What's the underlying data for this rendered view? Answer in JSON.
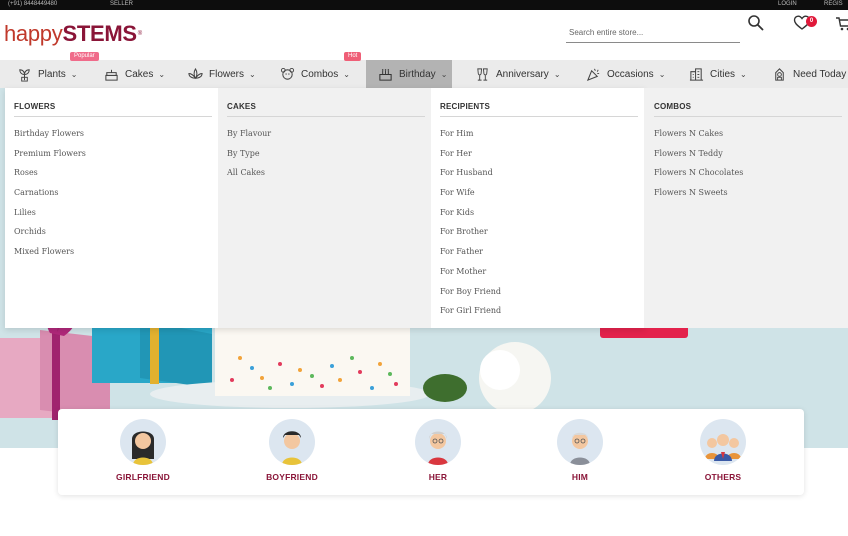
{
  "topbar": {
    "phone": "(+91) 8448449480",
    "seller": "SELLER",
    "login": "LOGIN",
    "register": "REGIS"
  },
  "header": {
    "logo_part1": "happy",
    "logo_part2": "STEMS",
    "logo_mark": "®",
    "search_placeholder": "Search entire store...",
    "wishlist_count": "0"
  },
  "nav": {
    "items": [
      {
        "label": "Plants",
        "icon": "plant-icon"
      },
      {
        "label": "Cakes",
        "icon": "cake-icon"
      },
      {
        "label": "Flowers",
        "icon": "flower-icon"
      },
      {
        "label": "Combos",
        "icon": "combo-icon"
      },
      {
        "label": "Birthday",
        "icon": "birthday-cake-icon"
      },
      {
        "label": "Anniversary",
        "icon": "wine-glasses-icon"
      },
      {
        "label": "Occasions",
        "icon": "party-popper-icon"
      },
      {
        "label": "Cities",
        "icon": "city-buildings-icon"
      },
      {
        "label": "Need Today",
        "icon": "clock-tower-icon"
      }
    ],
    "tags": {
      "plants": "Popular",
      "combos": "Hot"
    },
    "active": "Birthday"
  },
  "mega_menu": {
    "columns": [
      {
        "heading": "FLOWERS",
        "links": [
          "Birthday Flowers",
          "Premium Flowers",
          "Roses",
          "Carnations",
          "Lilies",
          "Orchids",
          "Mixed Flowers"
        ]
      },
      {
        "heading": "CAKES",
        "links": [
          "By Flavour",
          "By Type",
          "All Cakes"
        ]
      },
      {
        "heading": "RECIPIENTS",
        "links": [
          "For Him",
          "For Her",
          "For Husband",
          "For Wife",
          "For Kids",
          "For Brother",
          "For Father",
          "For Mother",
          "For Boy Friend",
          "For Girl Friend"
        ]
      },
      {
        "heading": "COMBOS",
        "links": [
          "Flowers N Cakes",
          "Flowers N Teddy",
          "Flowers N Chocolates",
          "Flowers N Sweets"
        ]
      }
    ]
  },
  "relations": {
    "items": [
      {
        "label": "GIRLFRIEND"
      },
      {
        "label": "BOYFRIEND"
      },
      {
        "label": "HER"
      },
      {
        "label": "HIM"
      },
      {
        "label": "OTHERS"
      }
    ]
  },
  "colors": {
    "brand": "#8a1538",
    "accent": "#e3224c",
    "nav_bg": "#ebebeb",
    "nav_active": "#b3b3b3",
    "banner_bg": "#cfe3e7"
  }
}
